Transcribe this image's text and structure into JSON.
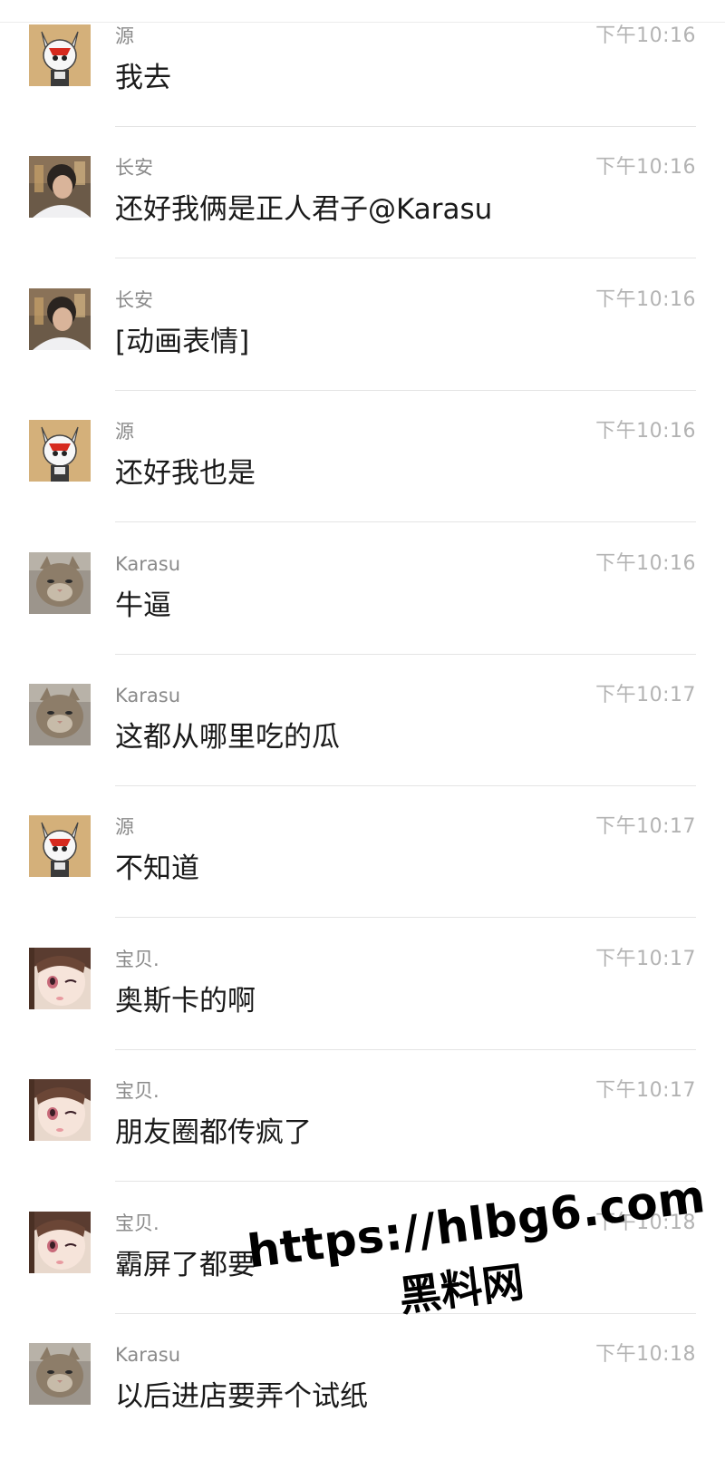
{
  "messages": [
    {
      "sender": "源",
      "time": "下午10:16",
      "text": "我去",
      "avatar": "robot-mascot-avatar"
    },
    {
      "sender": "长安",
      "time": "下午10:16",
      "text": "还好我俩是正人君子@Karasu",
      "avatar": "person-photo-avatar"
    },
    {
      "sender": "长安",
      "time": "下午10:16",
      "text": "[动画表情]",
      "avatar": "person-photo-avatar"
    },
    {
      "sender": "源",
      "time": "下午10:16",
      "text": "还好我也是",
      "avatar": "robot-mascot-avatar"
    },
    {
      "sender": "Karasu",
      "time": "下午10:16",
      "text": "牛逼",
      "avatar": "cat-photo-avatar"
    },
    {
      "sender": "Karasu",
      "time": "下午10:17",
      "text": "这都从哪里吃的瓜",
      "avatar": "cat-photo-avatar"
    },
    {
      "sender": "源",
      "time": "下午10:17",
      "text": "不知道",
      "avatar": "robot-mascot-avatar"
    },
    {
      "sender": "宝贝.",
      "time": "下午10:17",
      "text": "奥斯卡的啊",
      "avatar": "anime-girl-avatar"
    },
    {
      "sender": "宝贝.",
      "time": "下午10:17",
      "text": "朋友圈都传疯了",
      "avatar": "anime-girl-avatar"
    },
    {
      "sender": "宝贝.",
      "time": "下午10:18",
      "text": "霸屏了都要",
      "avatar": "anime-girl-avatar"
    },
    {
      "sender": "Karasu",
      "time": "下午10:18",
      "text": "以后进店要弄个试纸",
      "avatar": "cat-photo-avatar"
    }
  ],
  "watermark": {
    "url": "https://hlbg6.com",
    "name": "黑料网"
  }
}
